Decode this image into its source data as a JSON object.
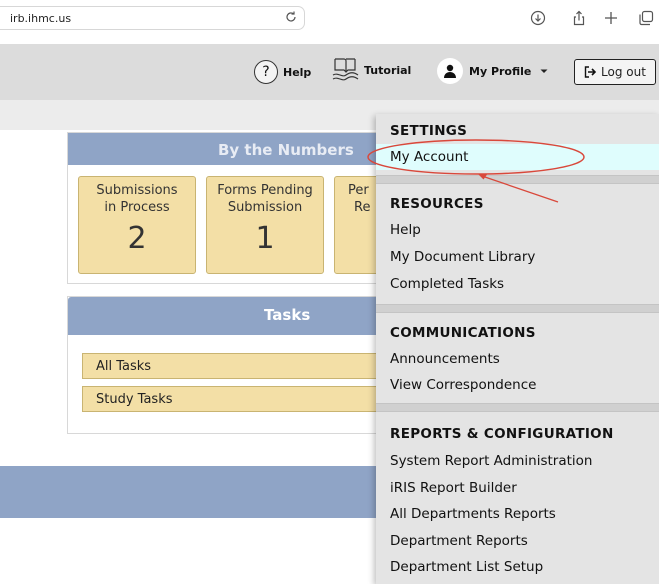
{
  "browser": {
    "url": "irb.ihmc.us",
    "icons": [
      "reload-icon",
      "download-icon",
      "share-icon",
      "new-tab-icon",
      "tabs-overview-icon"
    ]
  },
  "header": {
    "help_label": "Help",
    "tutorial_label": "Tutorial",
    "profile_label": "My Profile",
    "logout_label": "Log out"
  },
  "numbers": {
    "title": "By the Numbers",
    "cards": [
      {
        "label1": "Submissions",
        "label2": "in Process",
        "value": "2"
      },
      {
        "label1": "Forms Pending",
        "label2": "Submission",
        "value": "1"
      },
      {
        "label1": "Per",
        "label2": "Re",
        "value": ""
      }
    ]
  },
  "tasks": {
    "title": "Tasks",
    "items": [
      "All Tasks",
      "Study Tasks"
    ]
  },
  "menu": {
    "settings_title": "SETTINGS",
    "settings_items": [
      "My Account"
    ],
    "resources_title": "RESOURCES",
    "resources_items": [
      "Help",
      "My Document Library",
      "Completed Tasks"
    ],
    "communications_title": "COMMUNICATIONS",
    "communications_items": [
      "Announcements",
      "View Correspondence"
    ],
    "reports_title": "REPORTS & CONFIGURATION",
    "reports_items": [
      "System Report Administration",
      "iRIS Report Builder",
      "All Departments Reports",
      "Department Reports",
      "Department List Setup"
    ]
  },
  "colors": {
    "header_bg": "#dcdcdc",
    "panel_header": "#8fa4c6",
    "card_bg": "#f3dfa6",
    "menu_bg": "#e4e4e4",
    "active_item": "#dffdfd",
    "annotation_red": "#d9483b"
  }
}
